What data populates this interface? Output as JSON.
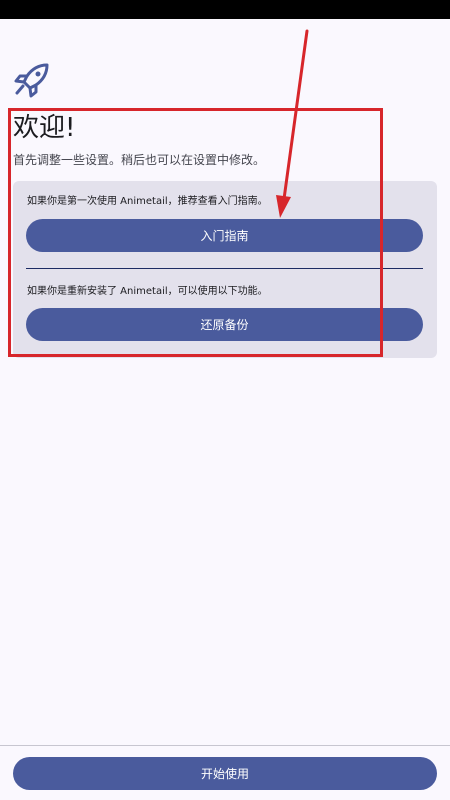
{
  "header": {
    "icon": "rocket-icon",
    "title": "欢迎!",
    "subtitle": "首先调整一些设置。稍后也可以在设置中修改。"
  },
  "card": {
    "guide_text": "如果你是第一次使用 Animetail，推荐查看入门指南。",
    "guide_button": "入门指南",
    "restore_text": "如果你是重新安装了 Animetail，可以使用以下功能。",
    "restore_button": "还原备份"
  },
  "footer": {
    "start_button": "开始使用"
  },
  "colors": {
    "accent": "#4a5b9d",
    "card_background": "#e3e1ec",
    "page_background": "#faf8fe",
    "annotation": "#d7262b"
  }
}
